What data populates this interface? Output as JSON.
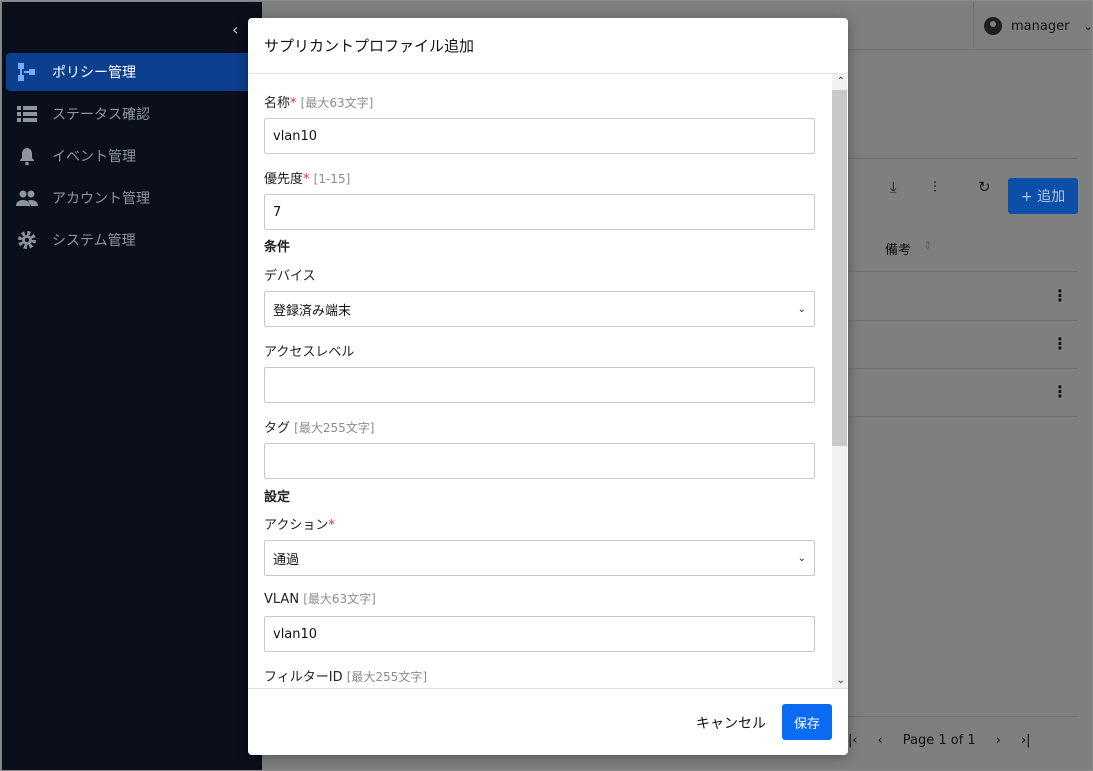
{
  "sidebar": {
    "items": [
      {
        "label": "ポリシー管理",
        "icon": "policy-tree-icon",
        "active": true
      },
      {
        "label": "ステータス確認",
        "icon": "list-icon",
        "active": false
      },
      {
        "label": "イベント管理",
        "icon": "bell-icon",
        "active": false
      },
      {
        "label": "アカウント管理",
        "icon": "people-icon",
        "active": false
      },
      {
        "label": "システム管理",
        "icon": "gear-icon",
        "active": false
      }
    ]
  },
  "header": {
    "user": "manager"
  },
  "background": {
    "add_label": "+ 追加",
    "column_header": "備考",
    "pager_label": "Page 1 of 1"
  },
  "modal": {
    "title": "サプリカントプロファイル追加",
    "fields": {
      "name": {
        "label": "名称",
        "hint": "[最大63文字]",
        "value": "vlan10"
      },
      "priority": {
        "label": "優先度",
        "hint": "[1-15]",
        "value": "7"
      },
      "condition_section": "条件",
      "device": {
        "label": "デバイス",
        "value": "登録済み端末"
      },
      "access_level": {
        "label": "アクセスレベル",
        "value": ""
      },
      "tag": {
        "label": "タグ",
        "hint": "[最大255文字]",
        "value": ""
      },
      "settings_section": "設定",
      "action": {
        "label": "アクション",
        "value": "通過"
      },
      "vlan": {
        "label": "VLAN",
        "hint": "[最大63文字]",
        "value": "vlan10"
      },
      "filter_id": {
        "label": "フィルターID",
        "hint": "[最大255文字]"
      }
    },
    "footer": {
      "cancel_label": "キャンセル",
      "save_label": "保存"
    }
  },
  "colors": {
    "accent": "#0b6cf3",
    "sidebar": "#0b0f1b",
    "required": "#d33333"
  }
}
